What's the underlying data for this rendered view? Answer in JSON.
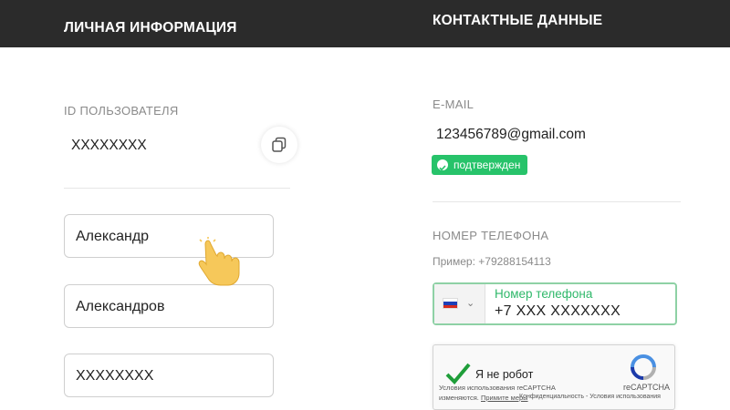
{
  "header": {
    "left_title": "ЛИЧНАЯ ИНФОРМАЦИЯ",
    "right_title": "КОНТАКТНЫЕ ДАННЫЕ"
  },
  "personal": {
    "user_id_label": "ID ПОЛЬЗОВАТЕЛЯ",
    "user_id_value": "XXXXXXXX",
    "copy_icon": "copy-icon",
    "first_name": "Александр",
    "last_name": "Александров",
    "third_field": "XXXXXXXX"
  },
  "contacts": {
    "email_label": "E-MAIL",
    "email_value": "123456789@gmail.com",
    "email_status": "подтвержден",
    "phone_label": "НОМЕР ТЕЛЕФОНА",
    "phone_example": "Пример: +79288154113",
    "phone_field_label": "Номер телефона",
    "phone_value": "+7  XXX XXXXXXX",
    "country_flag": "russia-flag-icon"
  },
  "captcha": {
    "label": "Я не робот",
    "brand": "reCAPTCHA",
    "terms_line1": "Условия использования reCAPTCHA",
    "terms_line2_prefix": "изменяются.",
    "terms_line2_link": "Примите меры",
    "terms_line3": "Конфиденциальность - Условия использования"
  },
  "colors": {
    "header_bg": "#2b2b2b",
    "accent_green": "#27c36a"
  }
}
